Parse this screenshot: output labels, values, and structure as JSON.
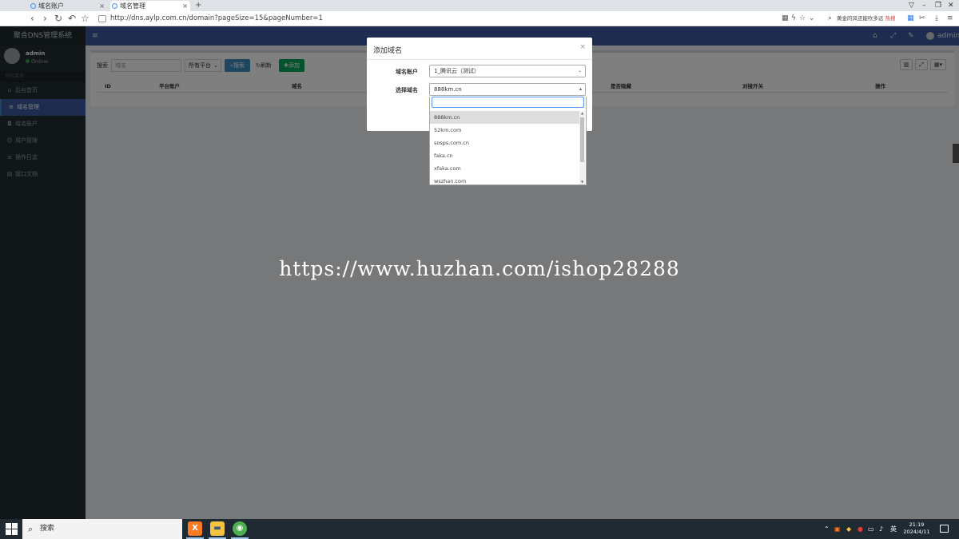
{
  "browser": {
    "tabs": [
      {
        "label": "域名账户",
        "active": false,
        "icon": "globe-icon"
      },
      {
        "label": "域名管理",
        "active": true,
        "icon": "globe-icon"
      }
    ],
    "new_tab_glyph": "+",
    "window_controls": [
      "▽",
      "–",
      "❐",
      "✕"
    ],
    "url": "http://dns.aylp.com.cn/domain?pageSize=15&pageNumber=1",
    "search_text": "黄金的风还能吹多远",
    "search_badge": "热搜"
  },
  "sidebar": {
    "title": "聚合DNS管理系统",
    "user": {
      "name": "admin",
      "status": "Online"
    },
    "nav_header": "导航菜单",
    "items": [
      {
        "label": "后台首页",
        "icon": "home-icon",
        "glyph": "⌂",
        "active": false
      },
      {
        "label": "域名管理",
        "icon": "list-icon",
        "glyph": "≡",
        "active": true
      },
      {
        "label": "域名账户",
        "icon": "lock-icon",
        "glyph": "◘",
        "active": false
      },
      {
        "label": "用户管理",
        "icon": "user-icon",
        "glyph": "☺",
        "active": false
      },
      {
        "label": "操作日志",
        "icon": "list-icon",
        "glyph": "≡",
        "active": false
      },
      {
        "label": "接口文档",
        "icon": "doc-icon",
        "glyph": "▤",
        "active": false
      }
    ]
  },
  "topnav": {
    "menu_glyph": "≡",
    "right_glyphs": [
      "⌂",
      "⤢",
      "✎"
    ],
    "user": "admin"
  },
  "toolbar": {
    "search_label": "搜索",
    "search_placeholder": "域名",
    "platform_select": "所有平台",
    "search_button": "搜索",
    "refresh_button": "刷新",
    "add_button": "添加",
    "accent_color": "#3c8dbc",
    "add_color": "#00a65a"
  },
  "table": {
    "columns": [
      "ID",
      "平台账户",
      "域名",
      "是否隐藏",
      "对接开关",
      "操作"
    ]
  },
  "modal": {
    "title": "添加域名",
    "close_glyph": "×",
    "account_label": "域名账户",
    "account_value": "1_腾讯云（测试）",
    "domain_label": "选择域名",
    "domain_value": "888km.cn",
    "dropdown_options": [
      "888km.cn",
      "52km.com",
      "sosps.com.cn",
      "faka.cn",
      "xfaka.com",
      "wszhan.com"
    ],
    "selected_option": "888km.cn"
  },
  "watermark": "https://www.huzhan.com/ishop28288",
  "taskbar": {
    "search_text": "搜索",
    "apps": [
      {
        "name": "xampp-icon",
        "glyph": "X",
        "color": "#fb7a24"
      },
      {
        "name": "file-explorer-icon",
        "glyph": "▬",
        "color": "#f5c242"
      },
      {
        "name": "browser-icon",
        "glyph": "◉",
        "color": "#4caf50"
      }
    ],
    "tray_lang": "英",
    "time": "21:19",
    "date": "2024/4/11"
  }
}
